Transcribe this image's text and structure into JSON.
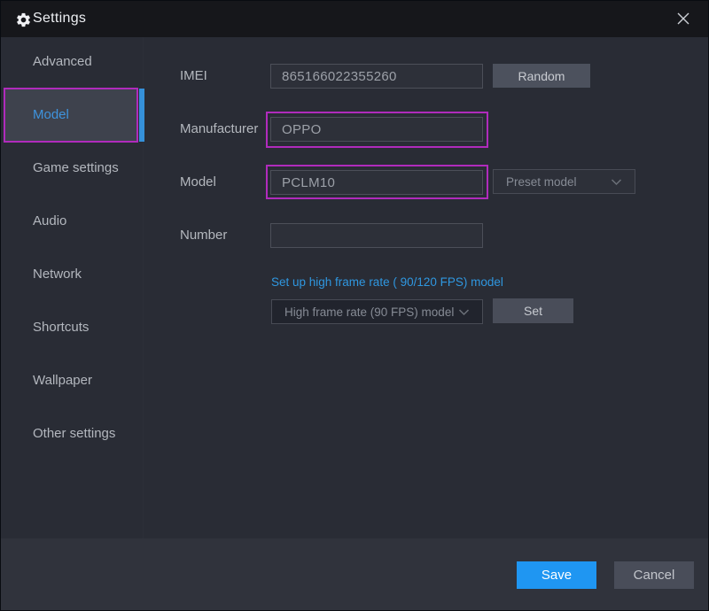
{
  "window": {
    "title": "Settings"
  },
  "sidebar": {
    "items": [
      {
        "label": "Advanced",
        "selected": false
      },
      {
        "label": "Model",
        "selected": true
      },
      {
        "label": "Game settings",
        "selected": false
      },
      {
        "label": "Audio",
        "selected": false
      },
      {
        "label": "Network",
        "selected": false
      },
      {
        "label": "Shortcuts",
        "selected": false
      },
      {
        "label": "Wallpaper",
        "selected": false
      },
      {
        "label": "Other settings",
        "selected": false
      }
    ]
  },
  "form": {
    "imei": {
      "label": "IMEI",
      "value": "865166022355260",
      "random_button": "Random"
    },
    "manufacturer": {
      "label": "Manufacturer",
      "value": "OPPO"
    },
    "model": {
      "label": "Model",
      "value": "PCLM10",
      "preset_dropdown": "Preset model"
    },
    "number": {
      "label": "Number",
      "value": ""
    },
    "high_frame_rate": {
      "link": "Set up high frame rate ( 90/120 FPS) model",
      "dropdown": "High frame rate (90 FPS) model",
      "set_button": "Set"
    }
  },
  "footer": {
    "save_button": "Save",
    "cancel_button": "Cancel"
  },
  "colors": {
    "accent_blue": "#2096f5",
    "highlight_magenta": "#b62bbc",
    "link_blue": "#2f97e0"
  }
}
